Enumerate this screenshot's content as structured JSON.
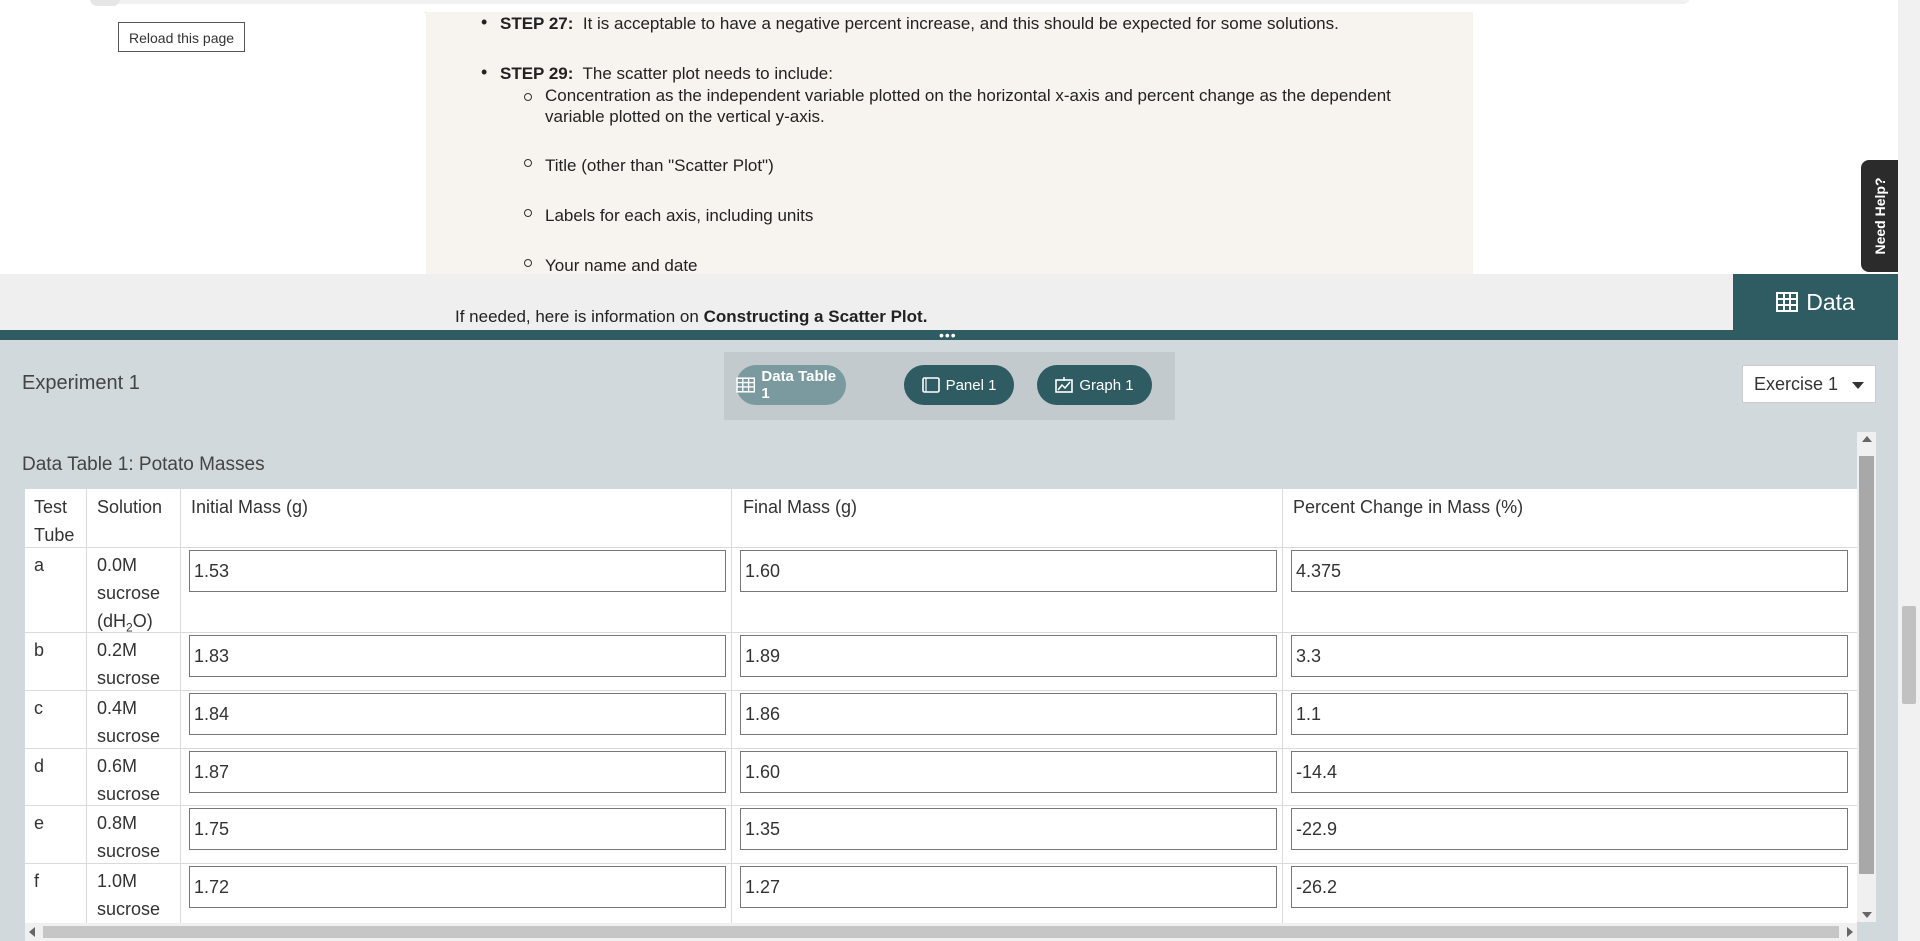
{
  "left": {
    "reload_label": "Reload this page"
  },
  "instructions": {
    "step27_label": "STEP 27:",
    "step27_text": "It is acceptable to have a negative percent increase, and this should be expected for some solutions.",
    "step29_label": "STEP 29:",
    "step29_text": "The scatter plot needs to include:",
    "sub_items": [
      "Concentration as the independent variable plotted on the horizontal x-axis and percent change as the dependent",
      "variable plotted on the vertical y-axis.",
      "Title (other than \"Scatter Plot\")",
      "Labels for each axis, including units",
      "Your name and date"
    ],
    "info_prefix": "If needed, here is information on",
    "info_link": "Constructing a Scatter Plot."
  },
  "need_help": "Need Help?",
  "data_tab": {
    "label": "Data",
    "icon": "table-icon"
  },
  "experiment": {
    "title": "Experiment 1",
    "tabs": [
      {
        "label": "Data Table 1",
        "icon": "table-icon",
        "active": true
      },
      {
        "label": "Panel 1",
        "icon": "panel-icon",
        "active": false
      },
      {
        "label": "Graph 1",
        "icon": "graph-icon",
        "active": false
      }
    ],
    "exercise": "Exercise 1"
  },
  "table": {
    "title": "Data Table 1: Potato Masses",
    "headers": {
      "tube_line1": "Test",
      "tube_line2": "Tube",
      "solution": "Solution",
      "initial": "Initial Mass (g)",
      "final": "Final Mass (g)",
      "percent": "Percent Change in Mass (%)"
    },
    "rows": [
      {
        "tube": "a",
        "sol1": "0.0M",
        "sol2": "sucrose",
        "sol3_pre": "(dH",
        "sol3_sub": "2",
        "sol3_post": "O)",
        "initial": "1.53",
        "final": "1.60",
        "percent": "4.375"
      },
      {
        "tube": "b",
        "sol1": "0.2M",
        "sol2": "sucrose",
        "initial": "1.83",
        "final": "1.89",
        "percent": "3.3"
      },
      {
        "tube": "c",
        "sol1": "0.4M",
        "sol2": "sucrose",
        "initial": "1.84",
        "final": "1.86",
        "percent": "1.1"
      },
      {
        "tube": "d",
        "sol1": "0.6M",
        "sol2": "sucrose",
        "initial": "1.87",
        "final": "1.60",
        "percent": "-14.4"
      },
      {
        "tube": "e",
        "sol1": "0.8M",
        "sol2": "sucrose",
        "initial": "1.75",
        "final": "1.35",
        "percent": "-22.9"
      },
      {
        "tube": "f",
        "sol1": "1.0M",
        "sol2": "sucrose",
        "initial": "1.72",
        "final": "1.27",
        "percent": "-26.2"
      }
    ]
  },
  "colors": {
    "accent": "#2f5b62",
    "panel_bg": "#d2d9dc",
    "active_tab": "#7a9a9f"
  }
}
